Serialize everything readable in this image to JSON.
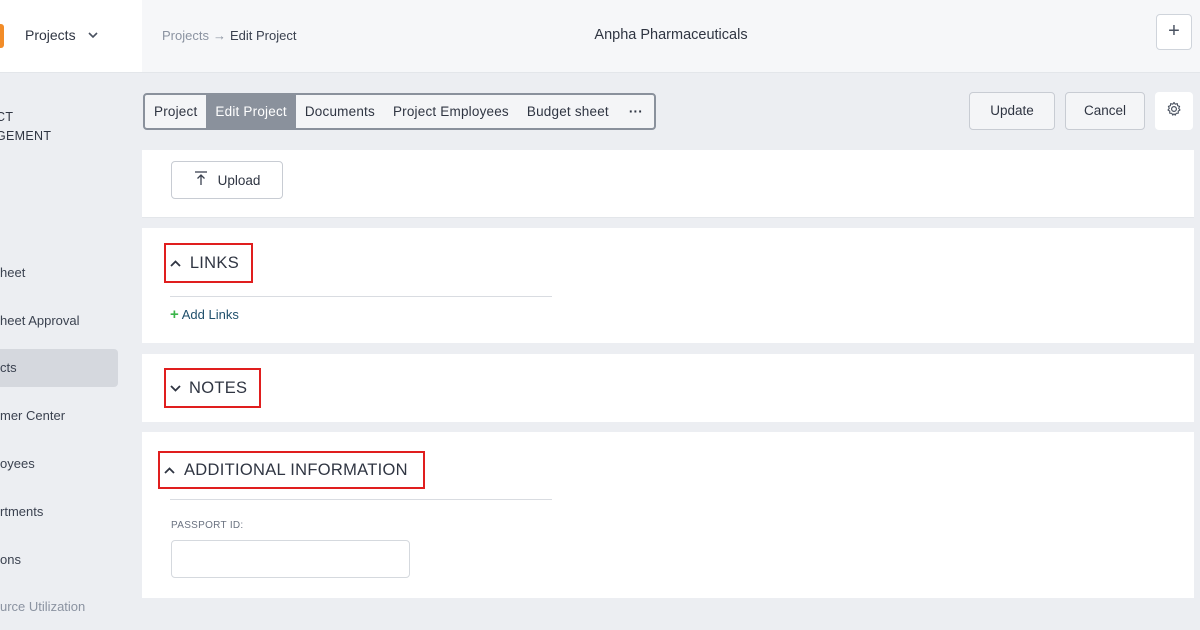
{
  "sidebar": {
    "project_selector": "Projects",
    "section_title_line1": "CT",
    "section_title_line2": "GEMENT",
    "items": [
      {
        "label": "heet"
      },
      {
        "label": "heet Approval"
      },
      {
        "label": "cts"
      },
      {
        "label": "mer Center"
      },
      {
        "label": "oyees"
      },
      {
        "label": "rtments"
      },
      {
        "label": "ons"
      },
      {
        "label": "urce Utilization"
      }
    ]
  },
  "header": {
    "breadcrumb_parent": "Projects",
    "breadcrumb_arrow": "→",
    "breadcrumb_current": "Edit Project",
    "company": "Anpha Pharmaceuticals",
    "add_label": "+"
  },
  "tabs": [
    {
      "label": "Project"
    },
    {
      "label": "Edit Project"
    },
    {
      "label": "Documents"
    },
    {
      "label": "Project Employees"
    },
    {
      "label": "Budget sheet"
    },
    {
      "label": "···"
    }
  ],
  "toolbar": {
    "update_label": "Update",
    "cancel_label": "Cancel"
  },
  "upload": {
    "label": "Upload"
  },
  "links": {
    "title": "LINKS",
    "add_label": "Add Links",
    "add_plus": "+"
  },
  "notes": {
    "title": "NOTES"
  },
  "additional": {
    "title": "ADDITIONAL INFORMATION",
    "passport_label": "PASSPORT ID:",
    "passport_value": ""
  },
  "colors": {
    "accent_orange": "#f28c28",
    "active_tab": "#8a919c",
    "highlight_red": "#e01e1e",
    "add_green": "#3bb54a"
  }
}
